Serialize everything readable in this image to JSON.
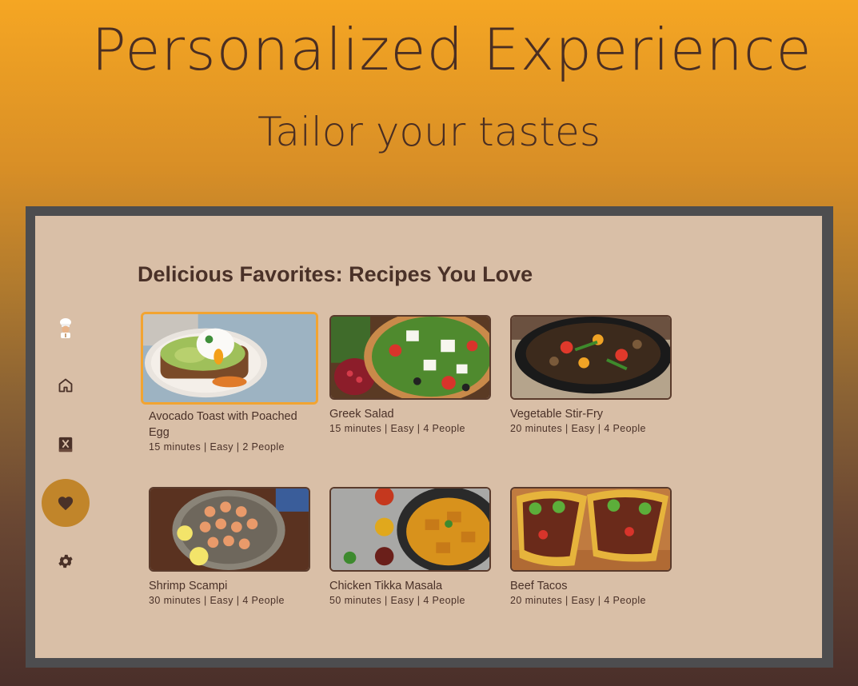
{
  "hero": {
    "title": "Personalized Experience",
    "subtitle": "Tailor your tastes"
  },
  "sidebar": {
    "items": [
      {
        "icon": "chef-avatar-icon",
        "active": false
      },
      {
        "icon": "home-icon",
        "active": false
      },
      {
        "icon": "recipe-book-icon",
        "active": false
      },
      {
        "icon": "heart-icon",
        "active": true
      },
      {
        "icon": "gear-icon",
        "active": false
      }
    ],
    "active_color": "#c1852a"
  },
  "main": {
    "section_title": "Delicious Favorites: Recipes You Love",
    "recipes": [
      {
        "title": "Avocado Toast with Poached Egg",
        "meta": "15 minutes | Easy | 2 People",
        "selected": true
      },
      {
        "title": "Greek Salad",
        "meta": "15 minutes | Easy | 4 People",
        "selected": false
      },
      {
        "title": "Vegetable Stir-Fry",
        "meta": "20 minutes | Easy | 4 People",
        "selected": false
      },
      {
        "title": "Shrimp Scampi",
        "meta": "30 minutes | Easy | 4 People",
        "selected": false
      },
      {
        "title": "Chicken Tikka Masala",
        "meta": "50 minutes | Easy | 4 People",
        "selected": false
      },
      {
        "title": "Beef Tacos",
        "meta": "20 minutes | Easy | 4 People",
        "selected": false
      }
    ]
  },
  "colors": {
    "screen_background": "#d9bfa7",
    "text": "#4a3128",
    "focus_border": "#f2a431",
    "bezel": "#4d4d4f"
  }
}
